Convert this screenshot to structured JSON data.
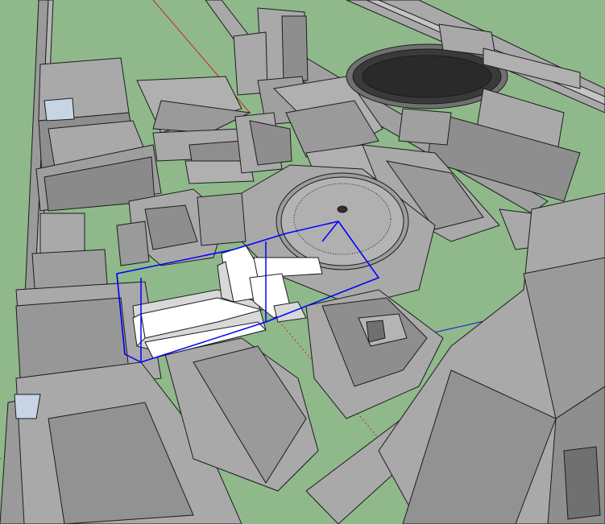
{
  "viewport": {
    "background_color": "#8fb98b",
    "building_fill": "#a9a9a9",
    "building_shadow_fill": "#8e8e8e",
    "roof_light_fill": "#c4c4c4",
    "edge_color": "#1c1c1c",
    "selection_color": "#0000ff",
    "selected_face_fill": "#ffffff",
    "selected_face_shade": "#d8d8d8"
  },
  "axes": {
    "red_axis_color": "#d02020",
    "green_axis_color": "#2a8a2a",
    "blue_axis_color": "#2020d0"
  },
  "selection": {
    "selected_group": "selected-building-model",
    "bounding_box_visible": true
  }
}
